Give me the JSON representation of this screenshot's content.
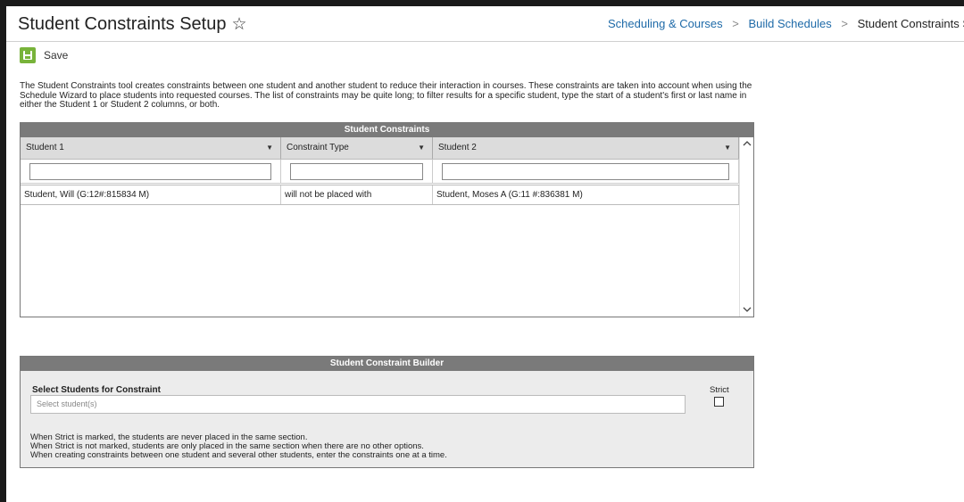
{
  "header": {
    "title": "Student Constraints Setup",
    "star_icon": "☆",
    "breadcrumb": [
      "Scheduling & Courses",
      "Build Schedules",
      "Student Constraints Setup"
    ]
  },
  "toolbar": {
    "save_label": "Save"
  },
  "description": "The Student Constraints tool creates constraints between one student and another student to reduce their interaction in courses. These constraints are taken into account when using the Schedule Wizard to place students into requested courses. The list of constraints may be quite long; to filter results for a specific student, type the start of a student's first or last name in either the Student 1 or Student 2 columns, or both.",
  "constraints_panel": {
    "title": "Student Constraints",
    "columns": [
      "Student 1",
      "Constraint Type",
      "Student 2"
    ],
    "rows": [
      [
        "Student, Will (G:12#:815834 M)",
        "will not be placed with",
        "Student, Moses A (G:11 #:836381 M)"
      ]
    ]
  },
  "builder_panel": {
    "title": "Student Constraint Builder",
    "select_label": "Select Students for Constraint",
    "select_placeholder": "Select student(s)",
    "strict_label": "Strict",
    "notes": [
      "When Strict is marked, the students are never placed in the same section.",
      "When Strict is not marked, students are only placed in the same section when there are no other options.",
      "When creating constraints between one student and several other students, enter the constraints one at a time."
    ]
  },
  "colors": {
    "accent": "#1e6aa8",
    "save_green": "#78b33a",
    "panel_header": "#7a7a7a"
  }
}
